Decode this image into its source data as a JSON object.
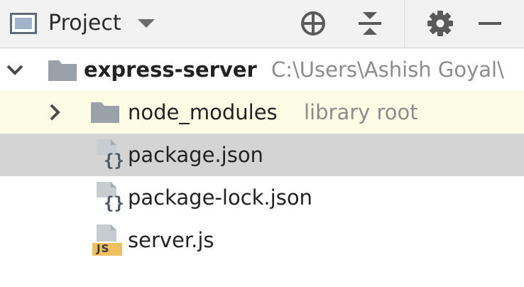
{
  "toolbar": {
    "title": "Project",
    "icons": {
      "view": "project-window-icon",
      "dropdown": "chevron-down-icon",
      "locate": "crosshair-icon",
      "collapse": "collapse-all-icon",
      "settings": "gear-icon",
      "hide": "minimize-icon"
    }
  },
  "tree": {
    "root": {
      "name": "express-server",
      "path": "C:\\Users\\Ashish Goyal\\",
      "expanded": true
    },
    "items": [
      {
        "name": "node_modules",
        "secondary": "library root",
        "type": "folder",
        "expanded": false
      },
      {
        "name": "package.json",
        "type": "json-file"
      },
      {
        "name": "package-lock.json",
        "type": "json-file"
      },
      {
        "name": "server.js",
        "type": "js-file",
        "badge": "JS"
      }
    ]
  },
  "colors": {
    "toolbar_bg": "#f2f2f2",
    "hover_row": "#fdfde6",
    "selected_row": "#d4d4d4",
    "folder_icon": "#9aa1a8",
    "js_badge": "#f0c060",
    "muted_text": "#8c8c8c"
  }
}
